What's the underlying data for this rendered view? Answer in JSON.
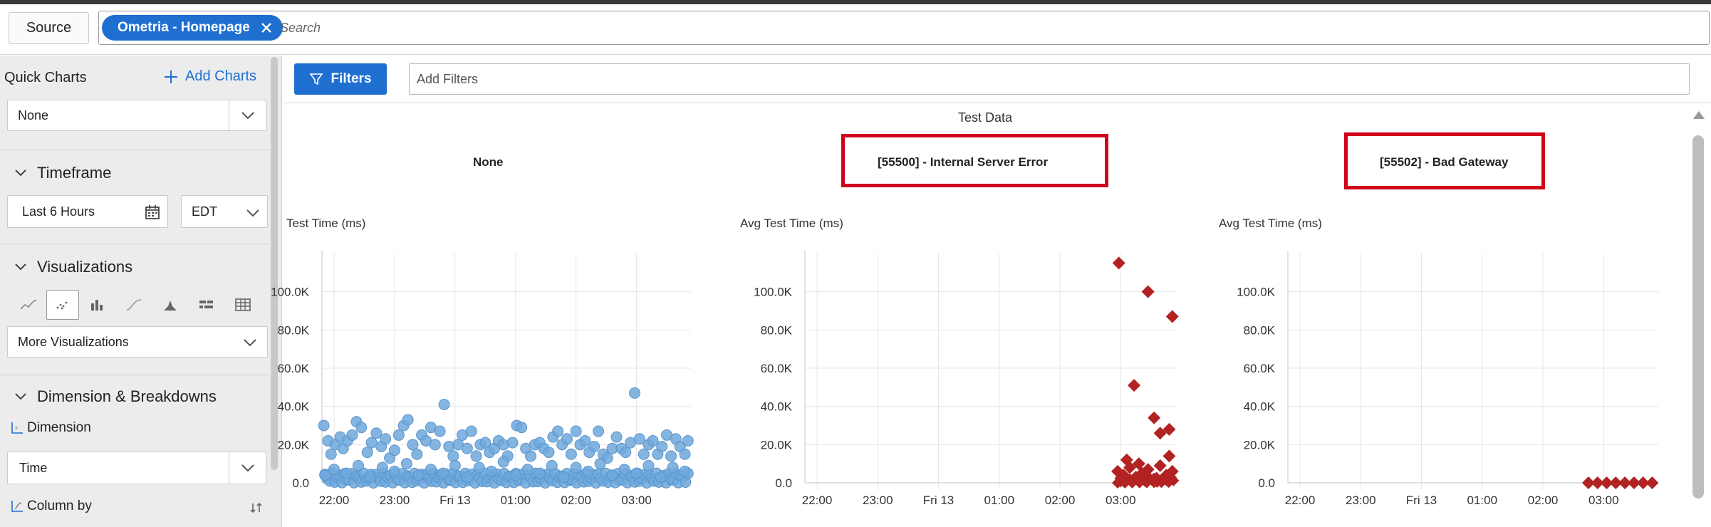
{
  "header": {
    "source_label": "Source",
    "chip_label": "Ometria - Homepage",
    "search_placeholder": "Search"
  },
  "sidebar": {
    "quick_charts_label": "Quick Charts",
    "add_charts_label": "Add Charts",
    "quick_chart_selected": "None",
    "timeframe_label": "Timeframe",
    "timeframe_value": "Last 6 Hours",
    "timezone_value": "EDT",
    "visualizations_label": "Visualizations",
    "viz_icons": [
      "line-chart-icon",
      "scatter-chart-icon",
      "bar-chart-icon",
      "curve-chart-icon",
      "stacked-area-icon",
      "split-bar-icon",
      "table-icon"
    ],
    "more_viz_label": "More Visualizations",
    "dimension_section_label": "Dimension & Breakdowns",
    "dimension_label": "Dimension",
    "dimension_value": "Time",
    "column_by_label": "Column by"
  },
  "main": {
    "filters_label": "Filters",
    "filters_placeholder": "Add Filters",
    "dataset_title": "Test Data",
    "accent_color": "#1f6fd1",
    "highlight_color": "#d0021b"
  },
  "chart_data": [
    {
      "type": "scatter",
      "title": "None",
      "ylabel": "Test Time (ms)",
      "x_ticks": [
        "22:00",
        "23:00",
        "Fri 13",
        "01:00",
        "02:00",
        "03:00"
      ],
      "y_ticks": [
        "0.0",
        "20.0K",
        "40.0K",
        "60.0K",
        "80.0K",
        "100.0K"
      ],
      "ylim": [
        0,
        120000
      ],
      "color": "#6fa8dc",
      "marker": "circle",
      "note": "dense points between 0 and ~28K across full time range, outliers ~41K at 23:50 and ~48K at 03:00",
      "points": [
        [
          21.83,
          30000
        ],
        [
          21.9,
          22000
        ],
        [
          21.95,
          15000
        ],
        [
          22.02,
          20000
        ],
        [
          22.1,
          24000
        ],
        [
          22.15,
          18000
        ],
        [
          22.22,
          22000
        ],
        [
          22.3,
          25000
        ],
        [
          22.37,
          32000
        ],
        [
          22.45,
          29000
        ],
        [
          22.55,
          16000
        ],
        [
          22.62,
          21000
        ],
        [
          22.7,
          26000
        ],
        [
          22.78,
          19000
        ],
        [
          22.85,
          23000
        ],
        [
          22.92,
          13000
        ],
        [
          23.0,
          17000
        ],
        [
          23.07,
          25000
        ],
        [
          23.15,
          30000
        ],
        [
          23.22,
          33000
        ],
        [
          23.3,
          20000
        ],
        [
          23.37,
          15000
        ],
        [
          23.45,
          25000
        ],
        [
          23.52,
          22000
        ],
        [
          23.6,
          29000
        ],
        [
          23.67,
          20000
        ],
        [
          23.75,
          27000
        ],
        [
          23.82,
          41000
        ],
        [
          23.9,
          19000
        ],
        [
          23.97,
          14000
        ],
        [
          24.05,
          20000
        ],
        [
          24.12,
          25000
        ],
        [
          24.2,
          18000
        ],
        [
          24.27,
          27000
        ],
        [
          24.35,
          14000
        ],
        [
          24.42,
          20000
        ],
        [
          24.5,
          21000
        ],
        [
          24.57,
          16000
        ],
        [
          24.65,
          18000
        ],
        [
          24.72,
          22000
        ],
        [
          24.8,
          20000
        ],
        [
          24.87,
          14000
        ],
        [
          24.95,
          21000
        ],
        [
          25.02,
          30000
        ],
        [
          25.1,
          29000
        ],
        [
          25.17,
          18000
        ],
        [
          25.25,
          14000
        ],
        [
          25.32,
          20000
        ],
        [
          25.4,
          21000
        ],
        [
          25.47,
          18000
        ],
        [
          25.55,
          16000
        ],
        [
          25.62,
          24000
        ],
        [
          25.7,
          27000
        ],
        [
          25.77,
          20000
        ],
        [
          25.85,
          23000
        ],
        [
          25.92,
          15000
        ],
        [
          26.0,
          27000
        ],
        [
          26.07,
          20000
        ],
        [
          26.15,
          22000
        ],
        [
          26.22,
          16000
        ],
        [
          26.3,
          19000
        ],
        [
          26.37,
          27000
        ],
        [
          26.45,
          15000
        ],
        [
          26.52,
          13000
        ],
        [
          26.6,
          18000
        ],
        [
          26.67,
          24000
        ],
        [
          26.75,
          18000
        ],
        [
          26.82,
          16000
        ],
        [
          26.9,
          21000
        ],
        [
          26.97,
          47000
        ],
        [
          27.05,
          23000
        ],
        [
          27.12,
          15000
        ],
        [
          27.2,
          20000
        ],
        [
          27.27,
          22000
        ],
        [
          27.35,
          15000
        ],
        [
          27.42,
          19000
        ],
        [
          27.5,
          25000
        ],
        [
          27.57,
          14000
        ],
        [
          27.65,
          23000
        ],
        [
          27.72,
          19000
        ],
        [
          27.8,
          15000
        ],
        [
          27.85,
          22000
        ],
        [
          21.85,
          4000
        ],
        [
          22.0,
          7000
        ],
        [
          22.2,
          5000
        ],
        [
          22.4,
          9000
        ],
        [
          22.6,
          3000
        ],
        [
          22.8,
          8000
        ],
        [
          23.0,
          6000
        ],
        [
          23.2,
          10000
        ],
        [
          23.4,
          4000
        ],
        [
          23.6,
          7000
        ],
        [
          23.8,
          5000
        ],
        [
          24.0,
          9000
        ],
        [
          24.2,
          3000
        ],
        [
          24.4,
          8000
        ],
        [
          24.6,
          6000
        ],
        [
          24.8,
          11000
        ],
        [
          25.0,
          4000
        ],
        [
          25.2,
          7000
        ],
        [
          25.4,
          5000
        ],
        [
          25.6,
          9000
        ],
        [
          25.8,
          3000
        ],
        [
          26.0,
          8000
        ],
        [
          26.2,
          6000
        ],
        [
          26.4,
          10000
        ],
        [
          26.6,
          4000
        ],
        [
          26.8,
          7000
        ],
        [
          27.0,
          5000
        ],
        [
          27.2,
          9000
        ],
        [
          27.4,
          3000
        ],
        [
          27.6,
          8000
        ],
        [
          27.8,
          6000
        ]
      ]
    },
    {
      "type": "scatter",
      "title": "[55500] - Internal Server Error",
      "ylabel": "Avg Test Time (ms)",
      "x_ticks": [
        "22:00",
        "23:00",
        "Fri 13",
        "01:00",
        "02:00",
        "03:00"
      ],
      "y_ticks": [
        "0.0",
        "20.0K",
        "40.0K",
        "60.0K",
        "80.0K",
        "100.0K"
      ],
      "ylim": [
        0,
        120000
      ],
      "color": "#b22222",
      "marker": "diamond",
      "points": [
        [
          26.97,
          115000
        ],
        [
          27.45,
          100000
        ],
        [
          27.85,
          87000
        ],
        [
          27.22,
          51000
        ],
        [
          27.55,
          34000
        ],
        [
          27.8,
          28000
        ],
        [
          27.65,
          26000
        ],
        [
          27.8,
          14000
        ],
        [
          27.1,
          12000
        ],
        [
          27.3,
          10000
        ],
        [
          26.95,
          6000
        ],
        [
          27.05,
          4000
        ],
        [
          27.15,
          8000
        ],
        [
          27.25,
          3000
        ],
        [
          27.35,
          5000
        ],
        [
          27.45,
          7000
        ],
        [
          27.55,
          2000
        ],
        [
          27.65,
          9000
        ],
        [
          27.75,
          4000
        ],
        [
          27.85,
          6000
        ],
        [
          27.0,
          1000
        ],
        [
          27.2,
          1500
        ],
        [
          27.4,
          1200
        ],
        [
          27.6,
          800
        ],
        [
          27.8,
          1000
        ]
      ]
    },
    {
      "type": "scatter",
      "title": "[55502] - Bad Gateway",
      "ylabel": "Avg Test Time (ms)",
      "x_ticks": [
        "22:00",
        "23:00",
        "Fri 13",
        "01:00",
        "02:00",
        "03:00"
      ],
      "y_ticks": [
        "0.0",
        "20.0K",
        "40.0K",
        "60.0K",
        "80.0K",
        "100.0K"
      ],
      "ylim": [
        0,
        120000
      ],
      "color": "#b22222",
      "marker": "diamond",
      "points": [
        [
          26.75,
          0
        ],
        [
          26.9,
          0
        ],
        [
          27.05,
          0
        ],
        [
          27.2,
          0
        ],
        [
          27.35,
          0
        ],
        [
          27.5,
          0
        ],
        [
          27.65,
          0
        ],
        [
          27.8,
          0
        ]
      ]
    }
  ]
}
